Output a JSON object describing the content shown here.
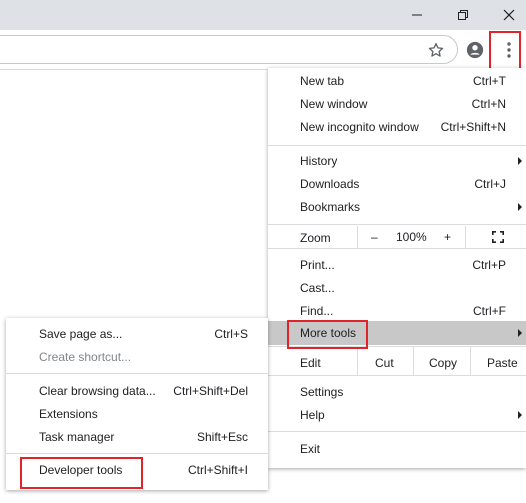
{
  "colors": {
    "highlight_box": "#e0242a",
    "menu_hover": "#c8c8c8",
    "titlebar": "#dee1e6"
  },
  "titlebar": {
    "icons": [
      "minimize-icon",
      "restore-icon",
      "close-icon"
    ]
  },
  "toolbar": {
    "icons": [
      "bookmark-star-icon",
      "profile-icon",
      "more-vertical-icon"
    ]
  },
  "menu": {
    "new_tab": {
      "label": "New tab",
      "shortcut": "Ctrl+T"
    },
    "new_window": {
      "label": "New window",
      "shortcut": "Ctrl+N"
    },
    "new_incognito": {
      "label": "New incognito window",
      "shortcut": "Ctrl+Shift+N"
    },
    "history": {
      "label": "History"
    },
    "downloads": {
      "label": "Downloads",
      "shortcut": "Ctrl+J"
    },
    "bookmarks": {
      "label": "Bookmarks"
    },
    "zoom": {
      "label": "Zoom",
      "minus": "–",
      "value": "100%",
      "plus": "+"
    },
    "print": {
      "label": "Print...",
      "shortcut": "Ctrl+P"
    },
    "cast": {
      "label": "Cast..."
    },
    "find": {
      "label": "Find...",
      "shortcut": "Ctrl+F"
    },
    "more_tools": {
      "label": "More tools"
    },
    "edit": {
      "label": "Edit",
      "cut": "Cut",
      "copy": "Copy",
      "paste": "Paste"
    },
    "settings": {
      "label": "Settings"
    },
    "help": {
      "label": "Help"
    },
    "exit": {
      "label": "Exit"
    }
  },
  "submenu": {
    "save_page": {
      "label": "Save page as...",
      "shortcut": "Ctrl+S"
    },
    "create_shortcut": {
      "label": "Create shortcut..."
    },
    "clear_data": {
      "label": "Clear browsing data...",
      "shortcut": "Ctrl+Shift+Del"
    },
    "extensions": {
      "label": "Extensions"
    },
    "task_manager": {
      "label": "Task manager",
      "shortcut": "Shift+Esc"
    },
    "developer_tools": {
      "label": "Developer tools",
      "shortcut": "Ctrl+Shift+I"
    }
  }
}
